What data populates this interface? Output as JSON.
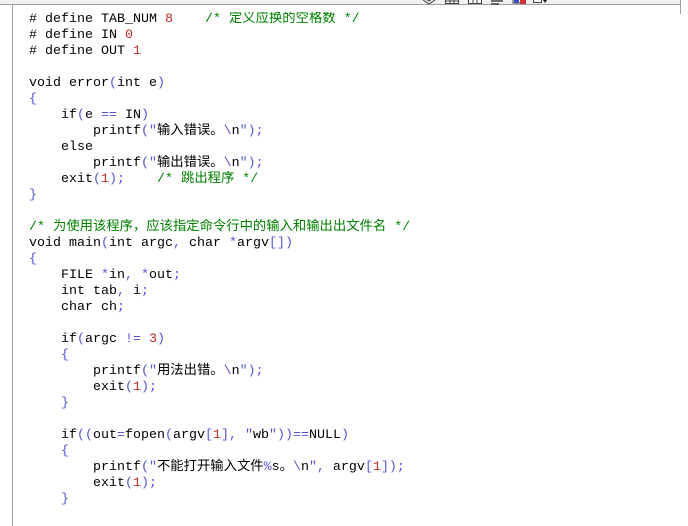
{
  "toolbar": {
    "icons": [
      "layers-icon",
      "table-icon",
      "grid-icon",
      "list-icon",
      "bookmark-icon",
      "dropdown-arrow-icon"
    ]
  },
  "editor": {
    "lines": [
      "# define TAB_NUM 8    /* 定义应换的空格数 */",
      "# define IN 0",
      "# define OUT 1",
      "",
      "void error(int e)",
      "{",
      "    if(e == IN)",
      "        printf(\"输入错误。\\n\");",
      "    else",
      "        printf(\"输出错误。\\n\");",
      "    exit(1);    /* 跳出程序 */",
      "}",
      "",
      "/* 为使用该程序，应该指定命令行中的输入和输出出文件名 */",
      "void main(int argc, char *argv[])",
      "{",
      "    FILE *in, *out;",
      "    int tab, i;",
      "    char ch;",
      "",
      "    if(argc != 3)",
      "    {",
      "        printf(\"用法出错。\\n\");",
      "        exit(1);",
      "    }",
      "",
      "    if((out=fopen(argv[1], \"wb\"))==NULL)",
      "    {",
      "        printf(\"不能打开输入文件%s。\\n\", argv[1]);",
      "        exit(1);",
      "    }"
    ]
  },
  "colors": {
    "background": "#ffffff",
    "text": "#000000",
    "punctuation": "#5555d8",
    "number": "#c02828",
    "comment": "#008000",
    "border": "#a0a0a0",
    "toolbar": "#f0f0f0"
  }
}
